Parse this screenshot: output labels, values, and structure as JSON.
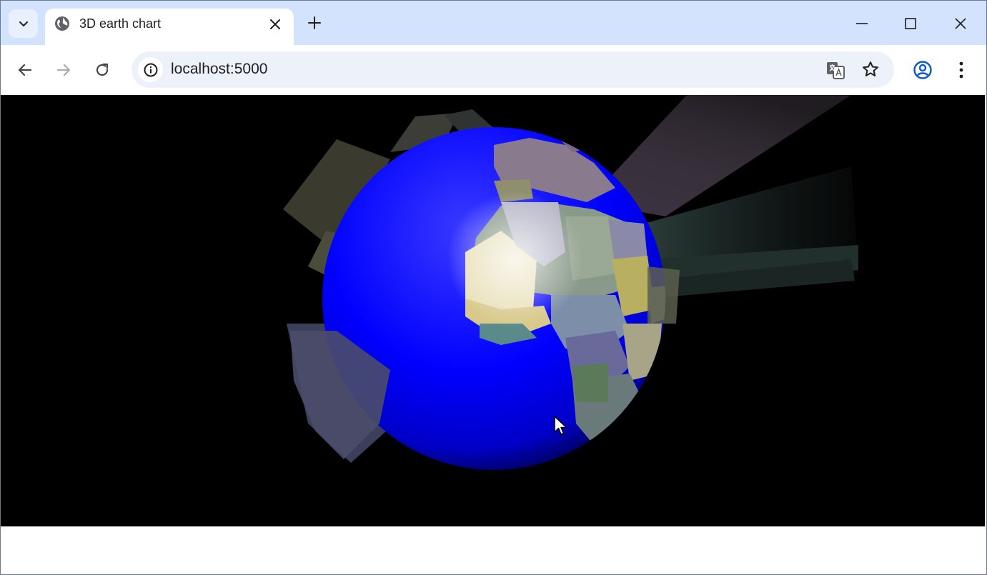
{
  "browser": {
    "tab": {
      "title": "3D earth chart"
    },
    "address_bar": {
      "url": "localhost:5000"
    }
  },
  "icons": {
    "tab_search": "chevron-down-icon",
    "favicon": "globe-icon",
    "tab_close": "close-icon",
    "new_tab": "plus-icon",
    "minimize": "minimize-icon",
    "maximize": "maximize-icon",
    "close_window": "close-icon",
    "back": "arrow-left-icon",
    "forward": "arrow-right-icon",
    "reload": "reload-icon",
    "site_info": "info-icon",
    "translate": "translate-icon",
    "bookmark": "star-icon",
    "profile": "profile-icon",
    "menu": "kebab-menu-icon",
    "cursor": "mouse-cursor-icon"
  },
  "colors": {
    "tabstrip": "#d3e3fd",
    "omnibox": "#edf2fa",
    "accent": "#0b57d0",
    "chart_background": "#000000",
    "ocean": "#0000ff"
  },
  "chart_data": {
    "type": "3d-globe",
    "title": "",
    "background": "#000000",
    "globe_color": "#0000ff",
    "projection": "orthographic globe centered on Africa and the Atlantic",
    "regions_visible": [
      "Africa",
      "Europe",
      "South America",
      "Middle East"
    ],
    "encoding": "countries extruded as 3D bars; region colors vary by country",
    "legend": false,
    "axes": false
  }
}
